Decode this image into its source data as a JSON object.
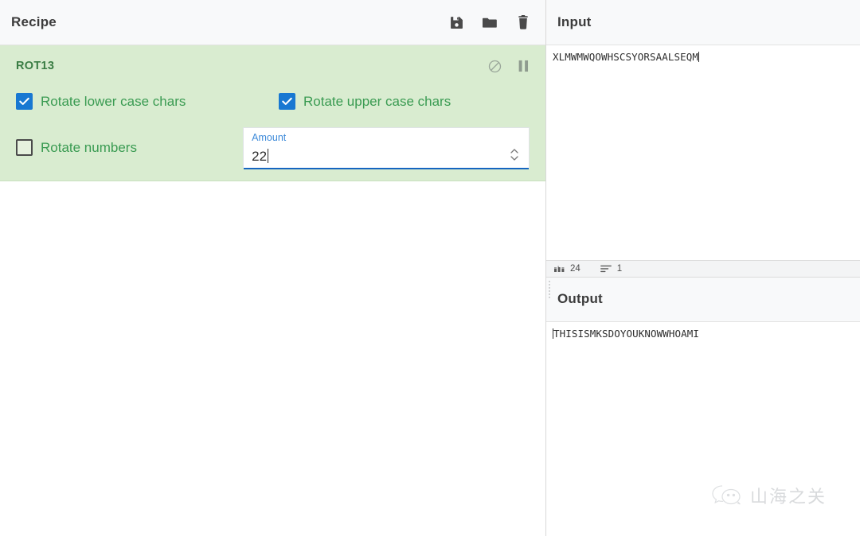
{
  "recipe": {
    "title": "Recipe",
    "toolbar": [
      {
        "name": "save-recipe-button",
        "icon": "floppy-disk-icon",
        "label": "Save recipe"
      },
      {
        "name": "load-recipe-button",
        "icon": "folder-icon",
        "label": "Load recipe"
      },
      {
        "name": "clear-recipe-button",
        "icon": "trash-icon",
        "label": "Clear recipe"
      }
    ],
    "operation": {
      "name": "ROT13",
      "icons": [
        {
          "name": "disable-operation-icon",
          "icon": "circle-slash-icon",
          "label": "Disable operation"
        },
        {
          "name": "set-breakpoint-icon",
          "icon": "pause-icon",
          "label": "Set breakpoint"
        }
      ],
      "args": {
        "rotate_lower": {
          "label": "Rotate lower case chars",
          "checked": true
        },
        "rotate_upper": {
          "label": "Rotate upper case chars",
          "checked": true
        },
        "rotate_numbers": {
          "label": "Rotate numbers",
          "checked": false
        },
        "amount": {
          "label": "Amount",
          "value": "22"
        }
      }
    }
  },
  "input": {
    "title": "Input",
    "value": "XLMWMWQOWHSCSYORSAALSEQM",
    "status": {
      "length_label": "24",
      "length_icon": "abc-icon",
      "lines_label": "1",
      "lines_icon": "lines-icon"
    }
  },
  "output": {
    "title": "Output",
    "value": "THISISMKSDOYOUKNOWWHOAMI"
  },
  "watermark": {
    "text": "山海之关",
    "icon": "wechat-icon"
  },
  "colors": {
    "operation_bg": "#d9ecd0",
    "operation_title": "#3a7d44",
    "checkbox_label": "#3a9b52",
    "checkbox_on": "#1878d2",
    "field_label": "#3d8ad9",
    "field_focus_underline": "#1565c0"
  }
}
